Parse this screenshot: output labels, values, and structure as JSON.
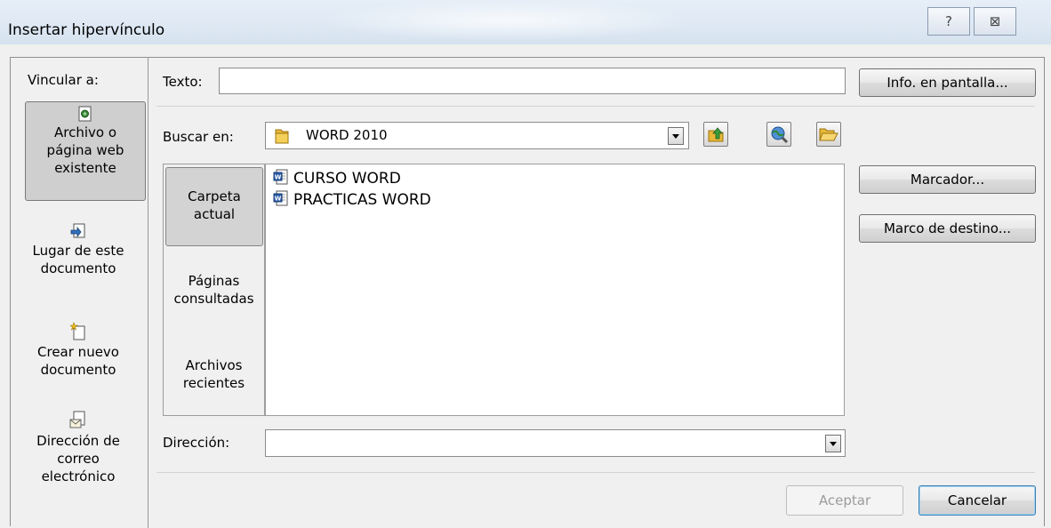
{
  "dialog": {
    "title": "Insertar hipervínculo",
    "help_glyph": "?",
    "close_glyph": "⊠"
  },
  "sidebar": {
    "heading": "Vincular a:",
    "items": [
      {
        "label_lines": [
          "Archivo o",
          "página web",
          "existente"
        ],
        "icon": "file-web-icon",
        "active": true
      },
      {
        "label_lines": [
          "Lugar de este",
          "documento"
        ],
        "icon": "place-in-document-icon",
        "active": false
      },
      {
        "label_lines": [
          "Crear nuevo",
          "documento"
        ],
        "icon": "new-document-icon",
        "active": false
      },
      {
        "label_lines": [
          "Dirección de",
          "correo",
          "electrónico"
        ],
        "icon": "email-icon",
        "active": false
      }
    ]
  },
  "text_field": {
    "label": "Texto:",
    "value": ""
  },
  "screentip_button": "Info. en pantalla...",
  "look_in": {
    "label": "Buscar en:",
    "value": "WORD 2010",
    "icon": "folder-icon"
  },
  "toolbar_icons": [
    "up-folder-icon",
    "browse-web-icon",
    "open-folder-icon"
  ],
  "tabs": [
    {
      "lines": [
        "Carpeta",
        "actual"
      ],
      "active": true
    },
    {
      "lines": [
        "Páginas",
        "consultadas"
      ],
      "active": false
    },
    {
      "lines": [
        "Archivos",
        "recientes"
      ],
      "active": false
    }
  ],
  "files": [
    {
      "name": "CURSO WORD",
      "icon": "word-document-icon"
    },
    {
      "name": "PRACTICAS WORD",
      "icon": "word-document-icon"
    }
  ],
  "bookmark_button": "Marcador...",
  "target_frame_button": "Marco de destino...",
  "address": {
    "label": "Dirección:",
    "value": ""
  },
  "buttons": {
    "ok": "Aceptar",
    "cancel": "Cancelar"
  },
  "colors": {
    "titlebar": "#dfe9f4",
    "dialog_bg": "#f0f0f0",
    "active_item": "#cfcfcf",
    "word_icon_blue": "#2a5caa",
    "folder_yellow": "#e8b838"
  }
}
